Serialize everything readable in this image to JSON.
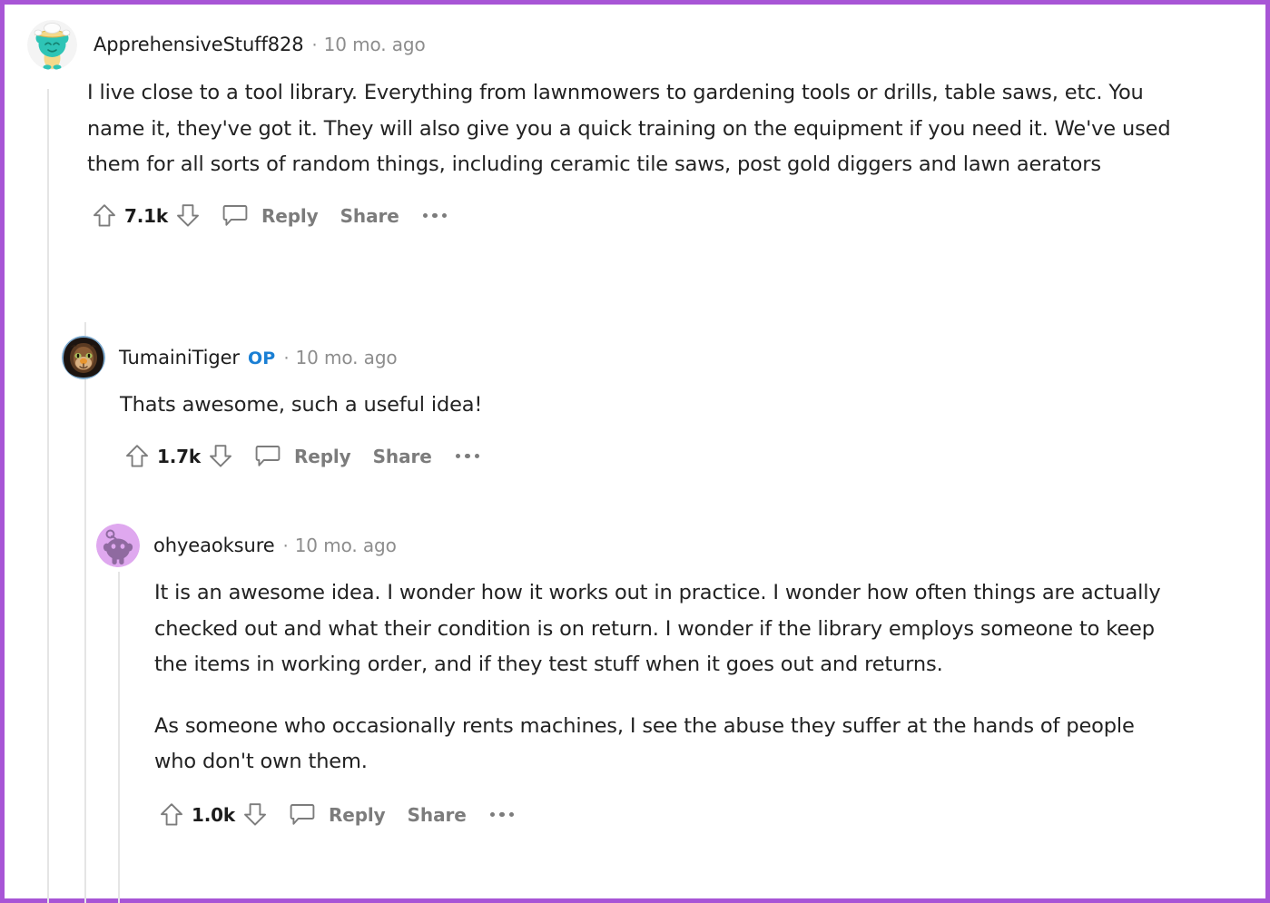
{
  "theme": {
    "page_border_color": "#a855d6",
    "background": "#ffffff",
    "text_color": "#222222",
    "muted_color": "#7c7c7c",
    "op_badge_color": "#1a7fd4",
    "thread_line_color": "#e5e5e5"
  },
  "comments": [
    {
      "author": "ApprehensiveStuff828",
      "op_badge": "",
      "separator": "·",
      "timestamp": "10 mo. ago",
      "avatar": {
        "name": "snoo-avatar-teal-gold",
        "circle_color": "#f2f2f2",
        "body_color": "#2ec4b6",
        "accent_color": "#f2cf66"
      },
      "paragraphs": [
        "I live close to a tool library. Everything from lawnmowers to gardening tools or drills, table saws, etc. You name it, they've got it. They will also give you a quick training on the equipment if you need it. We've used them for all sorts of random things, including ceramic tile saws, post gold diggers and lawn aerators"
      ],
      "actions": {
        "upvote": "upvote-arrow",
        "score": "7.1k",
        "downvote": "downvote-arrow",
        "comment": "comment-bubble",
        "reply_label": "Reply",
        "share_label": "Share",
        "more_label": "more-options"
      }
    },
    {
      "author": "TumainiTiger",
      "op_badge": "OP",
      "separator": "·",
      "timestamp": "10 mo. ago",
      "avatar": {
        "name": "lion-photo-avatar",
        "circle_color": "#1e1a17",
        "body_color": "#6b4a2f",
        "accent_color": "#e8952f"
      },
      "paragraphs": [
        "Thats awesome, such a useful idea!"
      ],
      "actions": {
        "upvote": "upvote-arrow",
        "score": "1.7k",
        "downvote": "downvote-arrow",
        "comment": "comment-bubble",
        "reply_label": "Reply",
        "share_label": "Share",
        "more_label": "more-options"
      }
    },
    {
      "author": "ohyeaoksure",
      "op_badge": "",
      "separator": "·",
      "timestamp": "10 mo. ago",
      "avatar": {
        "name": "snoo-avatar-purple",
        "circle_color": "#dfa8ef",
        "body_color": "#8f6aa0",
        "accent_color": "#8f6aa0"
      },
      "paragraphs": [
        "It is an awesome idea. I wonder how it works out in practice. I wonder how often things are actually checked out and what their condition is on return. I wonder if the library employs someone to keep the items in working order, and if they test stuff when it goes out and returns.",
        "As someone who occasionally rents machines, I see the abuse they suffer at the hands of people who don't own them."
      ],
      "actions": {
        "upvote": "upvote-arrow",
        "score": "1.0k",
        "downvote": "downvote-arrow",
        "comment": "comment-bubble",
        "reply_label": "Reply",
        "share_label": "Share",
        "more_label": "more-options"
      }
    }
  ]
}
